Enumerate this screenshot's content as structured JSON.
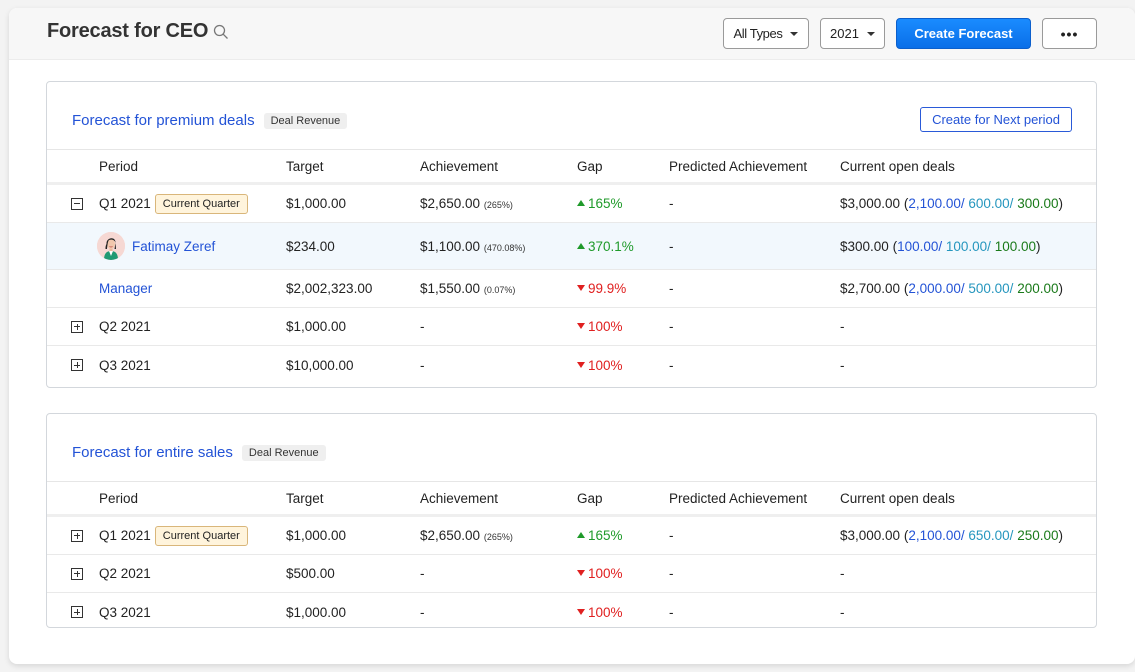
{
  "header": {
    "title": "Forecast for CEO",
    "type_filter": "All Types",
    "year_filter": "2021",
    "create_label": "Create Forecast",
    "more_label": "•••"
  },
  "columns": [
    "Period",
    "Target",
    "Achievement",
    "Gap",
    "Predicted Achievement",
    "Current open deals"
  ],
  "colors": {
    "accent": "#0a6fe8",
    "link": "#2353d6",
    "up": "#1f9a2a",
    "down": "#e02020",
    "open_1": "#2353d6",
    "open_2": "#2596be",
    "open_3": "#1a7a1a"
  },
  "forecasts": [
    {
      "title": "Forecast for premium deals",
      "tag": "Deal Revenue",
      "next_period_label": "Create for Next period",
      "rows": [
        {
          "expander": "minus",
          "period": "Q1 2021",
          "badge": "Current Quarter",
          "target": "$1,000.00",
          "achievement": "$2,650.00",
          "achievement_pct": "(265%)",
          "gap": "165%",
          "gap_dir": "up",
          "predicted": "-",
          "open_total": "$3,000.00",
          "open_parts": [
            "2,100.00/",
            "600.00/",
            "300.00"
          ]
        },
        {
          "type": "user",
          "name": "Fatimay Zeref",
          "target": "$234.00",
          "achievement": "$1,100.00",
          "achievement_pct": "(470.08%)",
          "gap": "370.1%",
          "gap_dir": "up",
          "predicted": "-",
          "open_total": "$300.00",
          "open_parts": [
            "100.00/",
            "100.00/",
            "100.00"
          ]
        },
        {
          "type": "role",
          "name": "Manager",
          "target": "$2,002,323.00",
          "achievement": "$1,550.00",
          "achievement_pct": "(0.07%)",
          "gap": "99.9%",
          "gap_dir": "down",
          "predicted": "-",
          "open_total": "$2,700.00",
          "open_parts": [
            "2,000.00/",
            "500.00/",
            "200.00"
          ]
        },
        {
          "expander": "plus",
          "period": "Q2 2021",
          "target": "$1,000.00",
          "achievement": "-",
          "gap": "100%",
          "gap_dir": "down",
          "predicted": "-",
          "open_total": "-"
        },
        {
          "expander": "plus",
          "period": "Q3 2021",
          "target": "$10,000.00",
          "achievement": "-",
          "gap": "100%",
          "gap_dir": "down",
          "predicted": "-",
          "open_total": "-"
        }
      ]
    },
    {
      "title": "Forecast for entire sales",
      "tag": "Deal Revenue",
      "rows": [
        {
          "expander": "plus",
          "period": "Q1 2021",
          "badge": "Current Quarter",
          "target": "$1,000.00",
          "achievement": "$2,650.00",
          "achievement_pct": "(265%)",
          "gap": "165%",
          "gap_dir": "up",
          "predicted": "-",
          "open_total": "$3,000.00",
          "open_parts": [
            "2,100.00/",
            "650.00/",
            "250.00"
          ]
        },
        {
          "expander": "plus",
          "period": "Q2 2021",
          "target": "$500.00",
          "achievement": "-",
          "gap": "100%",
          "gap_dir": "down",
          "predicted": "-",
          "open_total": "-"
        },
        {
          "expander": "plus",
          "period": "Q3 2021",
          "target": "$1,000.00",
          "achievement": "-",
          "gap": "100%",
          "gap_dir": "down",
          "predicted": "-",
          "open_total": "-"
        }
      ]
    }
  ]
}
